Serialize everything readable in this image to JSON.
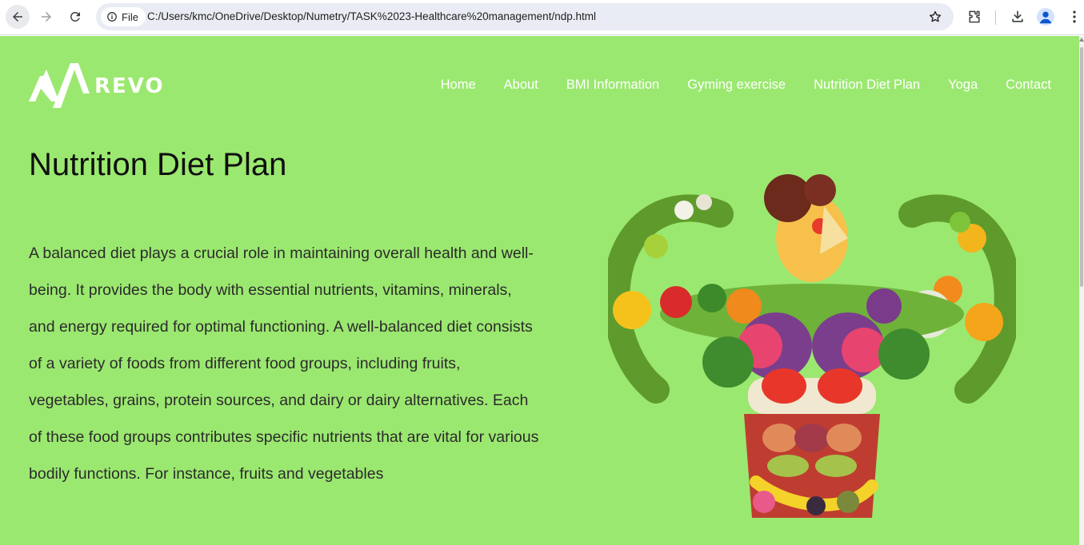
{
  "browser": {
    "site_chip": "File",
    "url": "C:/Users/kmc/OneDrive/Desktop/Numetry/TASK%2023-Healthcare%20management/ndp.html"
  },
  "site": {
    "logo_text": "REVO",
    "nav": [
      {
        "label": "Home"
      },
      {
        "label": "About"
      },
      {
        "label": "BMI Information"
      },
      {
        "label": "Gyming exercise"
      },
      {
        "label": "Nutrition Diet Plan"
      },
      {
        "label": "Yoga"
      },
      {
        "label": "Contact"
      }
    ]
  },
  "main": {
    "heading": "Nutrition Diet Plan",
    "paragraph": "A balanced diet plays a crucial role in maintaining overall health and well-being. It provides the body with essential nutrients, vitamins, minerals, and energy required for optimal functioning. A well-balanced diet consists of a variety of foods from different food groups, including fruits, vegetables, grains, protein sources, and dairy or dairy alternatives. Each of these food groups contributes specific nutrients that are vital for various bodily functions. For instance, fruits and vegetables"
  },
  "colors": {
    "page_background": "#9be870",
    "nav_text": "#ffffff"
  },
  "icons": [
    "back-icon",
    "forward-icon",
    "reload-icon",
    "info-icon",
    "star-icon",
    "extensions-icon",
    "download-icon",
    "profile-icon",
    "more-menu-icon"
  ]
}
